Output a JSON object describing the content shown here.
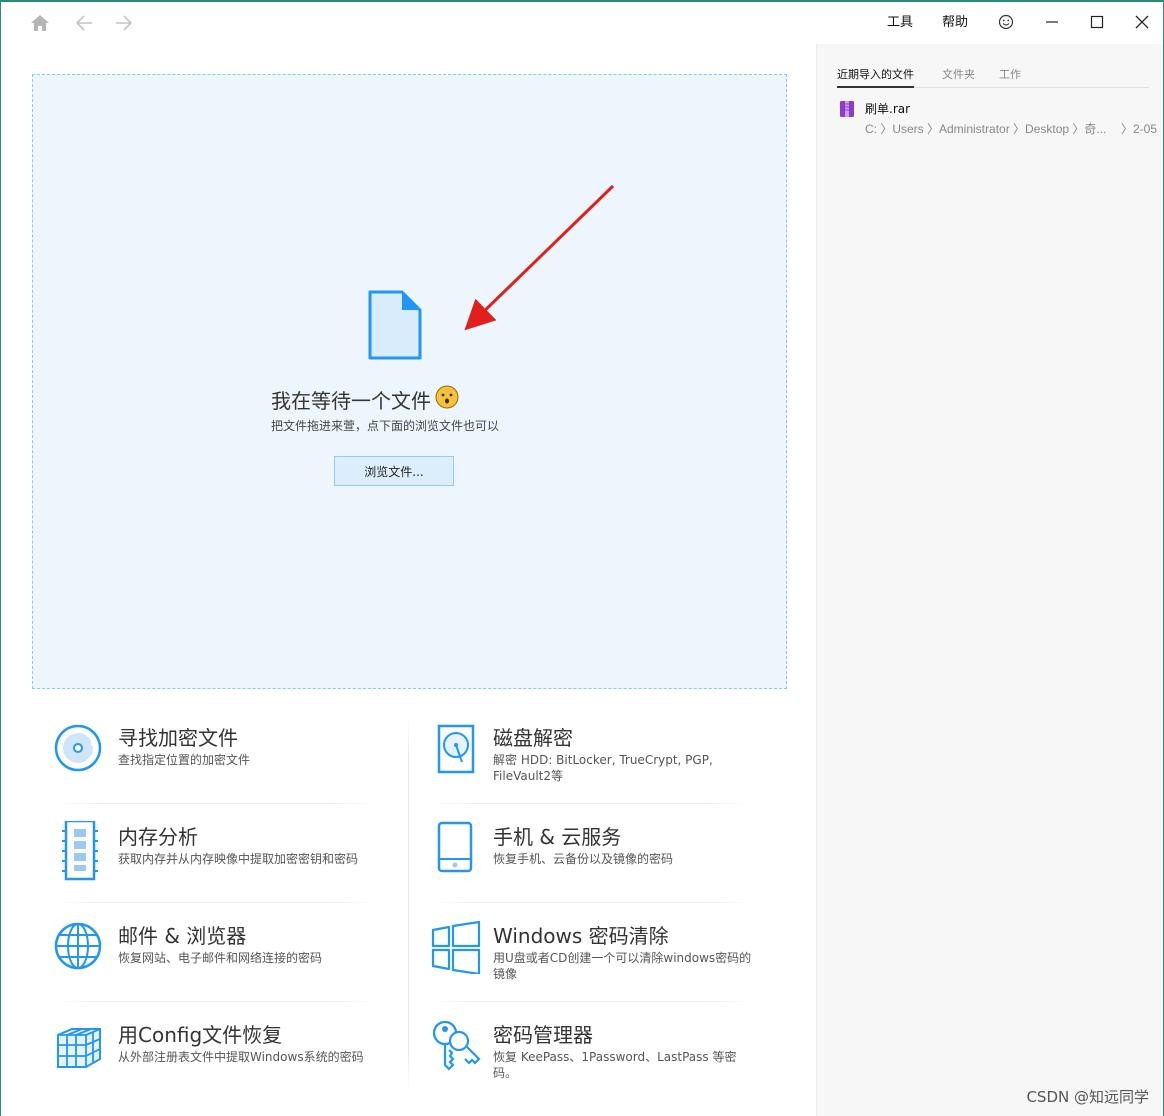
{
  "titlebar": {
    "tools_label": "工具",
    "help_label": "帮助"
  },
  "icons": {
    "home": "home-icon",
    "back": "arrow-left-icon",
    "forward": "arrow-right-icon",
    "feedback": "smiley-icon",
    "minimize": "minimize-icon",
    "maximize": "maximize-icon",
    "close": "close-icon"
  },
  "dropzone": {
    "title": "我在等待一个文件",
    "subtitle": "把文件拖进来萱，点下面的浏览文件也可以",
    "browse_label": "浏览文件..."
  },
  "features": [
    {
      "title": "寻找加密文件",
      "desc": "查找指定位置的加密文件",
      "icon": "disc-search-icon"
    },
    {
      "title": "磁盘解密",
      "desc": "解密 HDD: BitLocker, TrueCrypt, PGP, FileVault2等",
      "icon": "hard-disk-icon"
    },
    {
      "title": "内存分析",
      "desc": "获取内存并从内存映像中提取加密密钥和密码",
      "icon": "memory-icon"
    },
    {
      "title": "手机 & 云服务",
      "desc": "恢复手机、云备份以及镜像的密码",
      "icon": "phone-icon"
    },
    {
      "title": "邮件 & 浏览器",
      "desc": "恢复网站、电子邮件和网络连接的密码",
      "icon": "globe-icon"
    },
    {
      "title": "Windows 密码清除",
      "desc": "用U盘或者CD创建一个可以清除windows密码的镜像",
      "icon": "windows-icon"
    },
    {
      "title": "用Config文件恢复",
      "desc": "从外部注册表文件中提取Windows系统的密码",
      "icon": "cubes-icon"
    },
    {
      "title": "密码管理器",
      "desc": "恢复 KeePass、1Password、LastPass 等密码。",
      "icon": "keys-icon"
    }
  ],
  "side": {
    "tabs": [
      "近期导入的文件",
      "文件夹",
      "工作"
    ],
    "recent": [
      {
        "name": "刷单.rar",
        "path": "C: 〉Users 〉Administrator 〉Desktop 〉奇...",
        "date": "〉2-05",
        "icon": "rar-archive-icon"
      }
    ]
  },
  "watermark": "CSDN @知远同学",
  "colors": {
    "accent": "#2196f3",
    "dropzone_bg": "#eef6fd",
    "dropzone_border": "#8ec6ec",
    "arrow": "#e0201c",
    "rar_icon": "#8e3cc8"
  }
}
